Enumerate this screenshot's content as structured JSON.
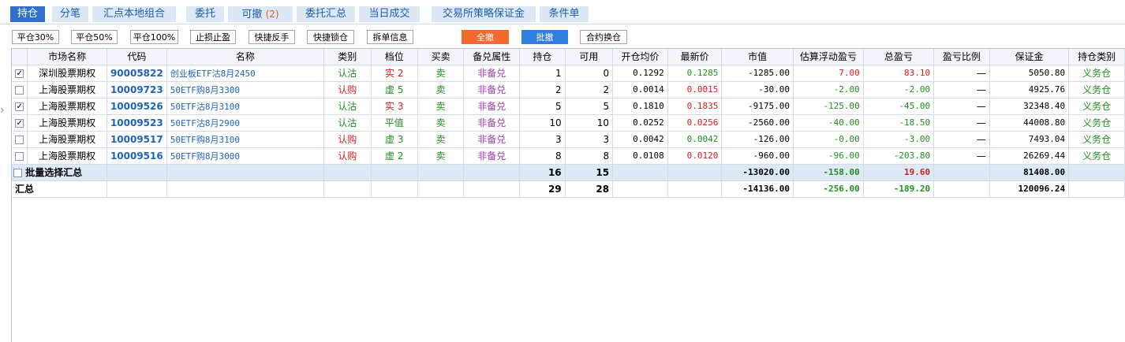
{
  "tabs": [
    {
      "label": "持仓",
      "active": true
    },
    {
      "label": "分笔",
      "active": false
    },
    {
      "label": "汇点本地组合",
      "active": false
    },
    {
      "label": "委托",
      "active": false
    },
    {
      "label": "可撤",
      "count": "(2)",
      "active": false
    },
    {
      "label": "委托汇总",
      "active": false
    },
    {
      "label": "当日成交",
      "active": false
    },
    {
      "label": "交易所策略保证金",
      "active": false
    },
    {
      "label": "条件单",
      "active": false
    }
  ],
  "toolbar": {
    "close30": "平仓30%",
    "close50": "平仓50%",
    "close100": "平仓100%",
    "stop": "止损止盈",
    "reverse": "快捷反手",
    "lock": "快捷锁仓",
    "split": "拆单信息",
    "cancel_all": "全撤",
    "batch_cancel": "批撤",
    "swap": "合约换仓"
  },
  "columns": [
    "市场名称",
    "代码",
    "名称",
    "类别",
    "档位",
    "买卖",
    "备兑属性",
    "持仓",
    "可用",
    "开仓均价",
    "最新价",
    "市值",
    "估算浮动盈亏",
    "总盈亏",
    "盈亏比例",
    "保证金",
    "持仓类别"
  ],
  "rows": [
    {
      "checked": true,
      "market": "深圳股票期权",
      "code": "90005822",
      "name": "创业板ETF沽8月2450",
      "type": "认沽",
      "level": "实 2",
      "side": "卖",
      "covered": "非备兑",
      "pos": "1",
      "avail": "0",
      "open_avg": "0.1292",
      "last": "0.1285",
      "mkt_value": "-1285.00",
      "float_pl": "7.00",
      "total_pl": "83.10",
      "pl_ratio": "—",
      "margin": "5050.80",
      "pos_type": "义务仓"
    },
    {
      "checked": false,
      "market": "上海股票期权",
      "code": "10009723",
      "name": "50ETF购8月3300",
      "type": "认购",
      "level": "虚 5",
      "side": "卖",
      "covered": "非备兑",
      "pos": "2",
      "avail": "2",
      "open_avg": "0.0014",
      "last": "0.0015",
      "mkt_value": "-30.00",
      "float_pl": "-2.00",
      "total_pl": "-2.00",
      "pl_ratio": "—",
      "margin": "4925.76",
      "pos_type": "义务仓"
    },
    {
      "checked": true,
      "market": "上海股票期权",
      "code": "10009526",
      "name": "50ETF沽8月3100",
      "type": "认沽",
      "level": "实 3",
      "side": "卖",
      "covered": "非备兑",
      "pos": "5",
      "avail": "5",
      "open_avg": "0.1810",
      "last": "0.1835",
      "mkt_value": "-9175.00",
      "float_pl": "-125.00",
      "total_pl": "-45.00",
      "pl_ratio": "—",
      "margin": "32348.40",
      "pos_type": "义务仓"
    },
    {
      "checked": true,
      "market": "上海股票期权",
      "code": "10009523",
      "name": "50ETF沽8月2900",
      "type": "认沽",
      "level": "平值",
      "side": "卖",
      "covered": "非备兑",
      "pos": "10",
      "avail": "10",
      "open_avg": "0.0252",
      "last": "0.0256",
      "mkt_value": "-2560.00",
      "float_pl": "-40.00",
      "total_pl": "-18.50",
      "pl_ratio": "—",
      "margin": "44008.80",
      "pos_type": "义务仓"
    },
    {
      "checked": false,
      "market": "上海股票期权",
      "code": "10009517",
      "name": "50ETF购8月3100",
      "type": "认购",
      "level": "虚 3",
      "side": "卖",
      "covered": "非备兑",
      "pos": "3",
      "avail": "3",
      "open_avg": "0.0042",
      "last": "0.0042",
      "mkt_value": "-126.00",
      "float_pl": "-0.00",
      "total_pl": "-3.00",
      "pl_ratio": "—",
      "margin": "7493.04",
      "pos_type": "义务仓"
    },
    {
      "checked": false,
      "market": "上海股票期权",
      "code": "10009516",
      "name": "50ETF购8月3000",
      "type": "认购",
      "level": "虚 2",
      "side": "卖",
      "covered": "非备兑",
      "pos": "8",
      "avail": "8",
      "open_avg": "0.0108",
      "last": "0.0120",
      "mkt_value": "-960.00",
      "float_pl": "-96.00",
      "total_pl": "-203.80",
      "pl_ratio": "—",
      "margin": "26269.44",
      "pos_type": "义务仓"
    }
  ],
  "summary_selected": {
    "label": "批量选择汇总",
    "pos": "16",
    "avail": "15",
    "mkt_value": "-13020.00",
    "float_pl": "-158.00",
    "total_pl": "19.60",
    "margin": "81408.00"
  },
  "summary_total": {
    "label": "汇总",
    "pos": "29",
    "avail": "28",
    "mkt_value": "-14136.00",
    "float_pl": "-256.00",
    "total_pl": "-189.20",
    "margin": "120096.24"
  },
  "colors": {
    "tab_active": "#2f6fd0",
    "tab_inactive": "#dce8f6",
    "cancel_all": "#f26a2e",
    "batch_cancel": "#2f7fe0",
    "code_blue": "#1f63b8",
    "profit_red": "#d22020",
    "loss_green": "#1f8f1f",
    "covered_purple": "#a03ab0"
  }
}
